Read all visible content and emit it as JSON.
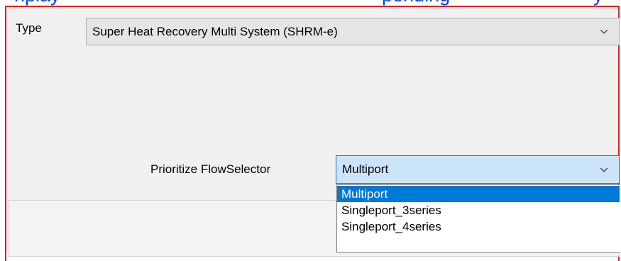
{
  "header_fragment": {
    "left": "nplay",
    "right": "pending",
    "right2": "y"
  },
  "type_field": {
    "label": "Type",
    "value": "Super Heat Recovery Multi System (SHRM-e)"
  },
  "prioritize_field": {
    "label": "Prioritize FlowSelector",
    "value": "Multiport",
    "options": [
      "Multiport",
      "Singleport_3series",
      "Singleport_4series"
    ],
    "selected_index": 0
  },
  "colors": {
    "accent": "#0078d7",
    "frame": "#e02020",
    "link_text": "#0645d6",
    "combo_focus_bg": "#cce4f7"
  },
  "icons": {
    "combo_arrow": "chevron-down-icon"
  }
}
